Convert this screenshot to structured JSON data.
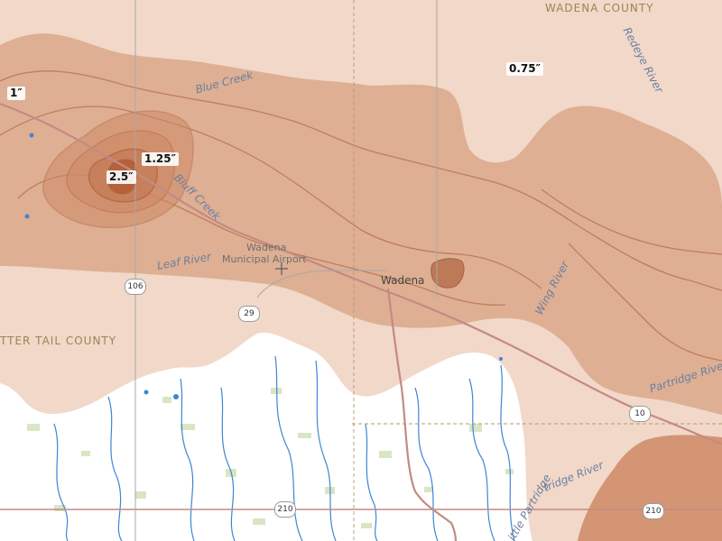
{
  "map": {
    "counties": {
      "wadena": "WADENA COUNTY",
      "otter_tail": "TTER TAIL COUNTY"
    },
    "waterways": {
      "blue_creek": "Blue Creek",
      "bluff_creek": "Bluff Creek",
      "leaf_river": "Leaf River",
      "redeye_river": "Redeye River",
      "wing_river": "Wing River",
      "partridge_river_east": "Partridge River",
      "partridge_river_south": "tridge River",
      "little_partridge_river": "ittle Partridge"
    },
    "places": {
      "airport_line1": "Wadena",
      "airport_line2": "Municipal Airport",
      "town": "Wadena"
    },
    "highways": {
      "h106": "106",
      "h29": "29",
      "h10": "10",
      "h210_a": "210",
      "h210_b": "210"
    },
    "depth_labels": {
      "d1": "1″",
      "d075": "0.75″",
      "d125": "1.25″",
      "d25": "2.5″"
    },
    "colors": {
      "light_band": "#f1d8c9",
      "mid_band": "#dba88a",
      "core": "#cf8a66",
      "contour": "#b8714f",
      "peak": "#b15c36",
      "uncovered": "#ffffff",
      "water": "#3f86d4",
      "road": "#c48a84"
    }
  }
}
